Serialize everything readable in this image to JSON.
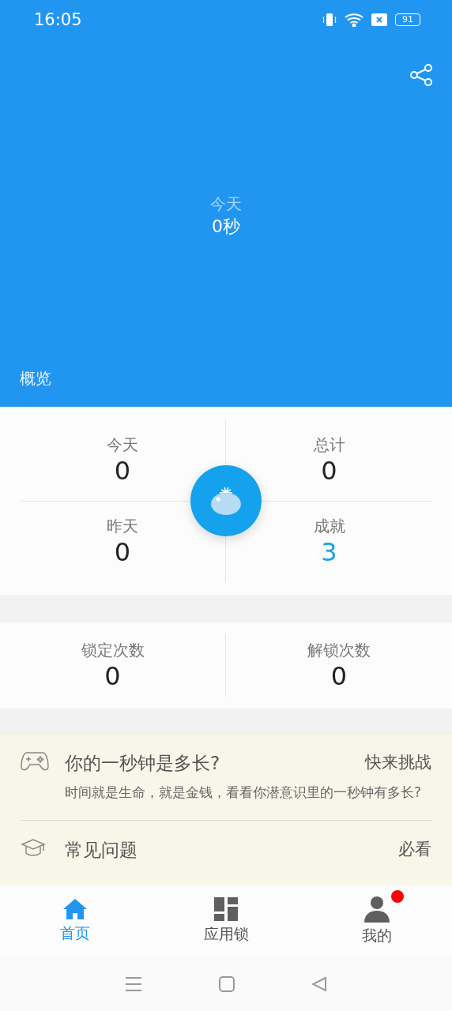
{
  "status_bar": {
    "time": "16:05",
    "battery": "91"
  },
  "header": {
    "label": "今天",
    "value": "0秒",
    "section": "概览"
  },
  "stats": [
    {
      "label": "今天",
      "value": "0",
      "highlight": false
    },
    {
      "label": "总计",
      "value": "0",
      "highlight": false
    },
    {
      "label": "昨天",
      "value": "0",
      "highlight": false
    },
    {
      "label": "成就",
      "value": "3",
      "highlight": true
    }
  ],
  "lock_stats": [
    {
      "label": "锁定次数",
      "value": "0"
    },
    {
      "label": "解锁次数",
      "value": "0"
    }
  ],
  "cards": [
    {
      "kind": "game",
      "title": "你的一秒钟是多长?",
      "action": "快来挑战",
      "description": "时间就是生命，就是金钱，看看你潜意识里的一秒钟有多长?"
    },
    {
      "kind": "faq",
      "title": "常见问题",
      "action": "必看"
    }
  ],
  "tabs": [
    {
      "kind": "home",
      "label": "首页",
      "selected": true,
      "badge": false
    },
    {
      "kind": "apps",
      "label": "应用锁",
      "selected": false,
      "badge": false
    },
    {
      "kind": "me",
      "label": "我的",
      "selected": false,
      "badge": true
    }
  ]
}
